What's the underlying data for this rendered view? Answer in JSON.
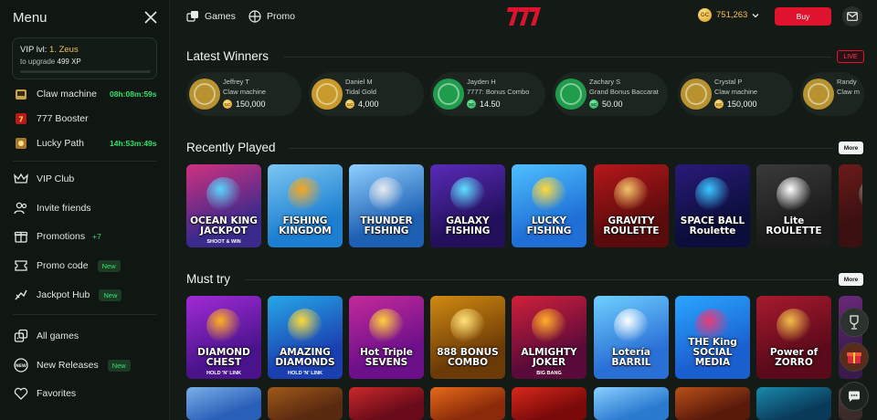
{
  "sidebar": {
    "title": "Menu",
    "vip": {
      "level_label": "VIP lvl:",
      "level_value": "1. Zeus",
      "upgrade_label": "to upgrade",
      "upgrade_value": "499 XP",
      "progress": 0.0
    },
    "featured": [
      {
        "label": "Claw machine",
        "timer": "08h:08m:59s"
      },
      {
        "label": "777 Booster",
        "timer": ""
      },
      {
        "label": "Lucky Path",
        "timer": "14h:53m:49s"
      }
    ],
    "nav": [
      {
        "label": "VIP Club",
        "icon": "crown-icon",
        "badge": ""
      },
      {
        "label": "Invite friends",
        "icon": "users-icon",
        "badge": ""
      },
      {
        "label": "Promotions",
        "icon": "gift-icon",
        "count": "+7"
      },
      {
        "label": "Promo code",
        "icon": "ticket-icon",
        "badge": "New"
      },
      {
        "label": "Jackpot Hub",
        "icon": "bullseye-icon",
        "badge": "New"
      }
    ],
    "games": [
      {
        "label": "All games",
        "icon": "dice-icon",
        "badge": ""
      },
      {
        "label": "New Releases",
        "icon": "new-icon",
        "badge": "New"
      },
      {
        "label": "Favorites",
        "icon": "heart-icon",
        "badge": ""
      }
    ]
  },
  "topbar": {
    "games_label": "Games",
    "promo_label": "Promo",
    "balance": "751,263",
    "coin_label": "GC",
    "buy_label": "Buy"
  },
  "latest_winners": {
    "title": "Latest Winners",
    "live_label": "LIVE",
    "items": [
      {
        "name": "Jeffrey T",
        "game": "Claw machine",
        "amount": "150,000",
        "coin": "GC",
        "color": "#b8922f"
      },
      {
        "name": "Daniel M",
        "game": "Tidal Gold",
        "amount": "4,000",
        "coin": "GC",
        "color": "#c89a2a"
      },
      {
        "name": "Jayden H",
        "game": "7777: Bonus Combo",
        "amount": "14.50",
        "coin": "SC",
        "color": "#1f9d4d"
      },
      {
        "name": "Zachary S",
        "game": "Grand Bonus Baccarat",
        "amount": "50.00",
        "coin": "SC",
        "color": "#1f9d4d"
      },
      {
        "name": "Crystal P",
        "game": "Claw machine",
        "amount": "150,000",
        "coin": "GC",
        "color": "#b8922f"
      },
      {
        "name": "Randy",
        "game": "Claw m",
        "amount": "",
        "coin": "GC",
        "color": "#b8922f"
      }
    ]
  },
  "recently_played": {
    "title": "Recently Played",
    "more_label": "More",
    "tiles": [
      {
        "title": "OCEAN KING JACKPOT",
        "sub": "SHOOT & WIN",
        "bg": "#3b2a8c",
        "bg2": "#d0317f",
        "accent": "#55d6ff"
      },
      {
        "title": "FISHING KINGDOM",
        "sub": "",
        "bg": "#1c7fd1",
        "bg2": "#7cc7f2",
        "accent": "#f5a623"
      },
      {
        "title": "THUNDER FISHING",
        "sub": "",
        "bg": "#1c5fb3",
        "bg2": "#8fd0ff",
        "accent": "#e8e8ee"
      },
      {
        "title": "GALAXY FISHING",
        "sub": "",
        "bg": "#22105c",
        "bg2": "#5a2bb8",
        "accent": "#5ee0ff"
      },
      {
        "title": "LUCKY FISHING",
        "sub": "",
        "bg": "#1f6fd6",
        "bg2": "#4fc0ff",
        "accent": "#ffd83a"
      },
      {
        "title": "GRAVITY ROULETTE",
        "sub": "",
        "bg": "#5a0b0b",
        "bg2": "#b5171b",
        "accent": "#f1c46a"
      },
      {
        "title": "SPACE BALL Roulette",
        "sub": "",
        "bg": "#0b0e3a",
        "bg2": "#2a1a7a",
        "accent": "#3ac8ff"
      },
      {
        "title": "Lite ROULETTE",
        "sub": "",
        "bg": "#1b1b1b",
        "bg2": "#3a3a3a",
        "accent": "#ffffff"
      },
      {
        "title": "",
        "sub": "",
        "bg": "#3a1010",
        "bg2": "#6b1a1a",
        "accent": "#999999"
      }
    ]
  },
  "must_try": {
    "title": "Must try",
    "more_label": "More",
    "tiles": [
      {
        "title": "DIAMOND CHEST",
        "sub": "HOLD 'N' LINK",
        "bg": "#4a138c",
        "bg2": "#a02bd6",
        "accent": "#ffb020"
      },
      {
        "title": "AMAZING DIAMONDS",
        "sub": "HOLD 'N' LINK",
        "bg": "#1a3fb0",
        "bg2": "#27a7e8",
        "accent": "#ffd83a"
      },
      {
        "title": "Hot Triple SEVENS",
        "sub": "",
        "bg": "#6b0f8a",
        "bg2": "#c42a9a",
        "accent": "#ffd23a"
      },
      {
        "title": "888 BONUS COMBO",
        "sub": "",
        "bg": "#6b3a07",
        "bg2": "#d08a12",
        "accent": "#ffe27a"
      },
      {
        "title": "ALMIGHTY JOKER",
        "sub": "BIG BANG",
        "bg": "#5a0a3a",
        "bg2": "#d0203a",
        "accent": "#ffb02a"
      },
      {
        "title": "Lotería BARRIL",
        "sub": "",
        "bg": "#2a6fd6",
        "bg2": "#6fd0ff",
        "accent": "#ffffff"
      },
      {
        "title": "THE King SOCIAL MEDIA",
        "sub": "",
        "bg": "#1a5fd0",
        "bg2": "#2aa6ff",
        "accent": "#e83a7a"
      },
      {
        "title": "Power of ZORRO",
        "sub": "",
        "bg": "#5a0a1a",
        "bg2": "#a81a2e",
        "accent": "#f2c04a"
      },
      {
        "title": "",
        "sub": "",
        "bg": "#3a1a4a",
        "bg2": "#6a2a7a",
        "accent": "#999999"
      }
    ]
  },
  "third_row": {
    "tiles": [
      {
        "bg": "#2a5fb8",
        "bg2": "#7ab0e8"
      },
      {
        "bg": "#5a2a10",
        "bg2": "#a05a1a"
      },
      {
        "bg": "#6a0a1a",
        "bg2": "#c82a2a"
      },
      {
        "bg": "#8a2a0a",
        "bg2": "#e86a1a"
      },
      {
        "bg": "#7a0a0a",
        "bg2": "#d8281a"
      },
      {
        "bg": "#2a7ad0",
        "bg2": "#8ad0ff"
      },
      {
        "bg": "#5a1a0a",
        "bg2": "#b8501a"
      },
      {
        "bg": "#0a3a5a",
        "bg2": "#1a8aaa"
      },
      {
        "bg": "#3a2a2a",
        "bg2": "#5a3a3a"
      }
    ]
  },
  "colors": {
    "accent_green": "#2fe06c",
    "brand_red": "#e0132e",
    "gold": "#f2c04a"
  }
}
